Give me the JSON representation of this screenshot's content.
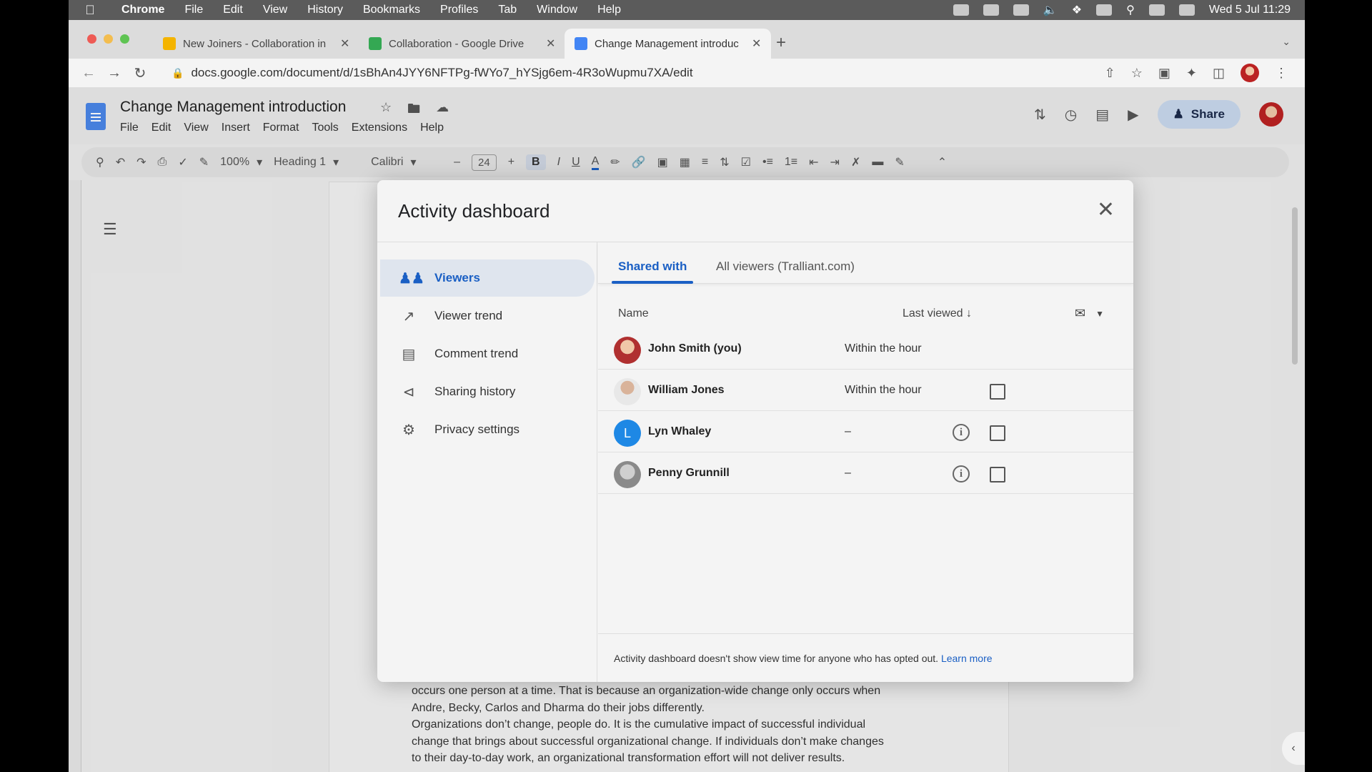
{
  "mac": {
    "menus": [
      "Chrome",
      "File",
      "Edit",
      "View",
      "History",
      "Bookmarks",
      "Profiles",
      "Tab",
      "Window",
      "Help"
    ],
    "clock": "Wed 5 Jul  11:29"
  },
  "browser": {
    "tabs": [
      {
        "title": "New Joiners - Collaboration in",
        "color": "#f4b400"
      },
      {
        "title": "Collaboration - Google Drive",
        "color": "#34a853"
      },
      {
        "title": "Change Management introduc",
        "color": "#4285f4"
      }
    ],
    "url": "docs.google.com/document/d/1sBhAn4JYY6NFTPg-fWYo7_hYSjg6em-4R3oWupmu7XA/edit"
  },
  "doc": {
    "title": "Change Management introduction",
    "menus": [
      "File",
      "Edit",
      "View",
      "Insert",
      "Format",
      "Tools",
      "Extensions",
      "Help"
    ],
    "share_label": "Share",
    "toolbar": {
      "zoom": "100%",
      "style": "Heading 1",
      "font": "Calibri",
      "font_size": "24",
      "minus": "–",
      "plus": "+",
      "bold": "B",
      "italic": "I",
      "underline": "U",
      "text_color": "A"
    },
    "body_lines": [
      "occurs one person at a time. That is because an organization-wide change only occurs when",
      "Andre, Becky, Carlos and Dharma do their jobs differently.",
      "Organizations don’t change, people do. It is the cumulative impact of successful individual",
      "change that brings about successful organizational change. If individuals don’t make changes",
      "to their day-to-day work, an organizational transformation effort will not deliver results."
    ]
  },
  "dialog": {
    "title": "Activity dashboard",
    "nav": [
      {
        "label": "Viewers",
        "icon": "people-icon"
      },
      {
        "label": "Viewer trend",
        "icon": "trend-icon"
      },
      {
        "label": "Comment trend",
        "icon": "comment-icon"
      },
      {
        "label": "Sharing history",
        "icon": "share-icon"
      },
      {
        "label": "Privacy settings",
        "icon": "gear-icon"
      }
    ],
    "tabs": [
      "Shared with",
      "All viewers (Tralliant.com)"
    ],
    "col_name": "Name",
    "col_last_viewed": "Last viewed",
    "rows": [
      {
        "name": "John Smith (you)",
        "last_viewed": "Within the hour",
        "avatar_color": "#b03030"
      },
      {
        "name": "William Jones",
        "last_viewed": "Within the hour",
        "avatar_color": "#9a7f6a"
      },
      {
        "name": "Lyn Whaley",
        "last_viewed": "–",
        "avatar_color": "#1e88e5",
        "initial": "L"
      },
      {
        "name": "Penny Grunnill",
        "last_viewed": "–",
        "avatar_color": "#a8a8a8"
      }
    ],
    "footer_text": "Activity dashboard doesn't show view time for anyone who has opted out.",
    "footer_link": "Learn more"
  }
}
